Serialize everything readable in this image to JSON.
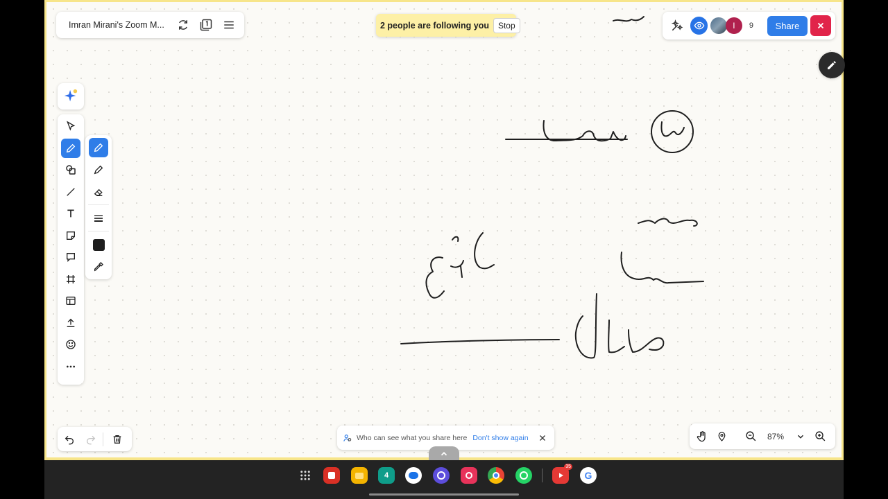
{
  "header": {
    "board_title": "Imran Mirani's Zoom M...",
    "follow_text": "2 people are following you",
    "stop_label": "Stop"
  },
  "collab": {
    "avatar_initial": "I",
    "user_count": "9",
    "share_label": "Share"
  },
  "notice": {
    "text": "Who can see what you share here",
    "dont_show_label": "Don't show again"
  },
  "zoom": {
    "level": "87%"
  },
  "taskbar": {
    "youtube_badge": "35"
  },
  "colors": {
    "accent": "#2f7de8",
    "banner": "#fdf0a6",
    "close_red": "#e1244a",
    "pen_color": "#1e1e1e"
  },
  "icons": {
    "top_left": [
      "sync-icon",
      "page-count-icon",
      "menu-icon"
    ],
    "tools": [
      "select-icon",
      "pen-icon",
      "shapes-icon",
      "line-icon",
      "text-icon",
      "sticky-note-icon",
      "comment-icon",
      "frame-icon",
      "template-icon",
      "upload-icon",
      "emoji-icon",
      "more-icon"
    ],
    "pen_panel": [
      "pen-icon",
      "highlighter-icon",
      "eraser-icon",
      "stroke-width-icon",
      "color-swatch",
      "eyedropper-icon"
    ]
  }
}
